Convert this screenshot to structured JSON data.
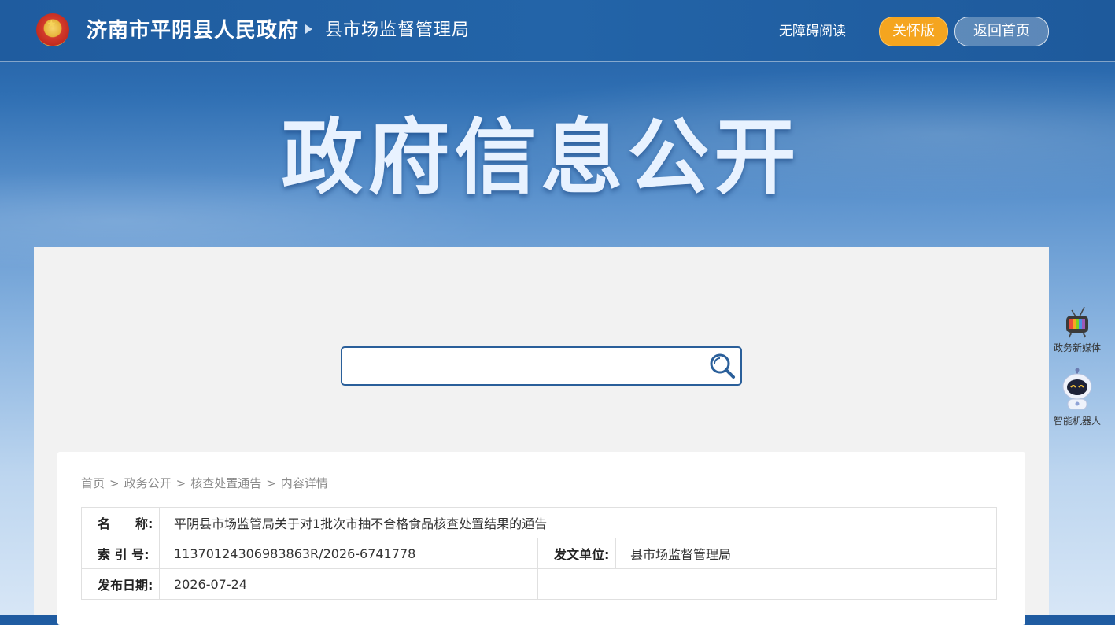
{
  "header": {
    "site_name": "济南市平阴县人民政府",
    "dept_name": "县市场监督管理局",
    "accessible_reading": "无障碍阅读",
    "care_mode": "关怀版",
    "back_home": "返回首页"
  },
  "banner": {
    "title": "政府信息公开"
  },
  "search": {
    "placeholder": "",
    "value": ""
  },
  "breadcrumb": {
    "items": [
      "首页",
      "政务公开",
      "核查处置通告",
      "内容详情"
    ],
    "separator": ">"
  },
  "info": {
    "name_label": "名　　称:",
    "name_value": "平阴县市场监管局关于对1批次市抽不合格食品核查处置结果的通告",
    "index_label": "索 引 号:",
    "index_value": "11370124306983863R/2026-6741778",
    "issuer_label": "发文单位:",
    "issuer_value": "县市场监督管理局",
    "date_label": "发布日期:",
    "date_value": "2026-07-24"
  },
  "side_widgets": [
    {
      "label": "政务新媒体",
      "icon": "tv-icon"
    },
    {
      "label": "智能机器人",
      "icon": "robot-icon"
    }
  ],
  "colors": {
    "header_bg": "#2364a8",
    "care_button": "#f5a51f",
    "search_border": "#2a5f9a",
    "panel_bg": "#f2f2f2"
  }
}
